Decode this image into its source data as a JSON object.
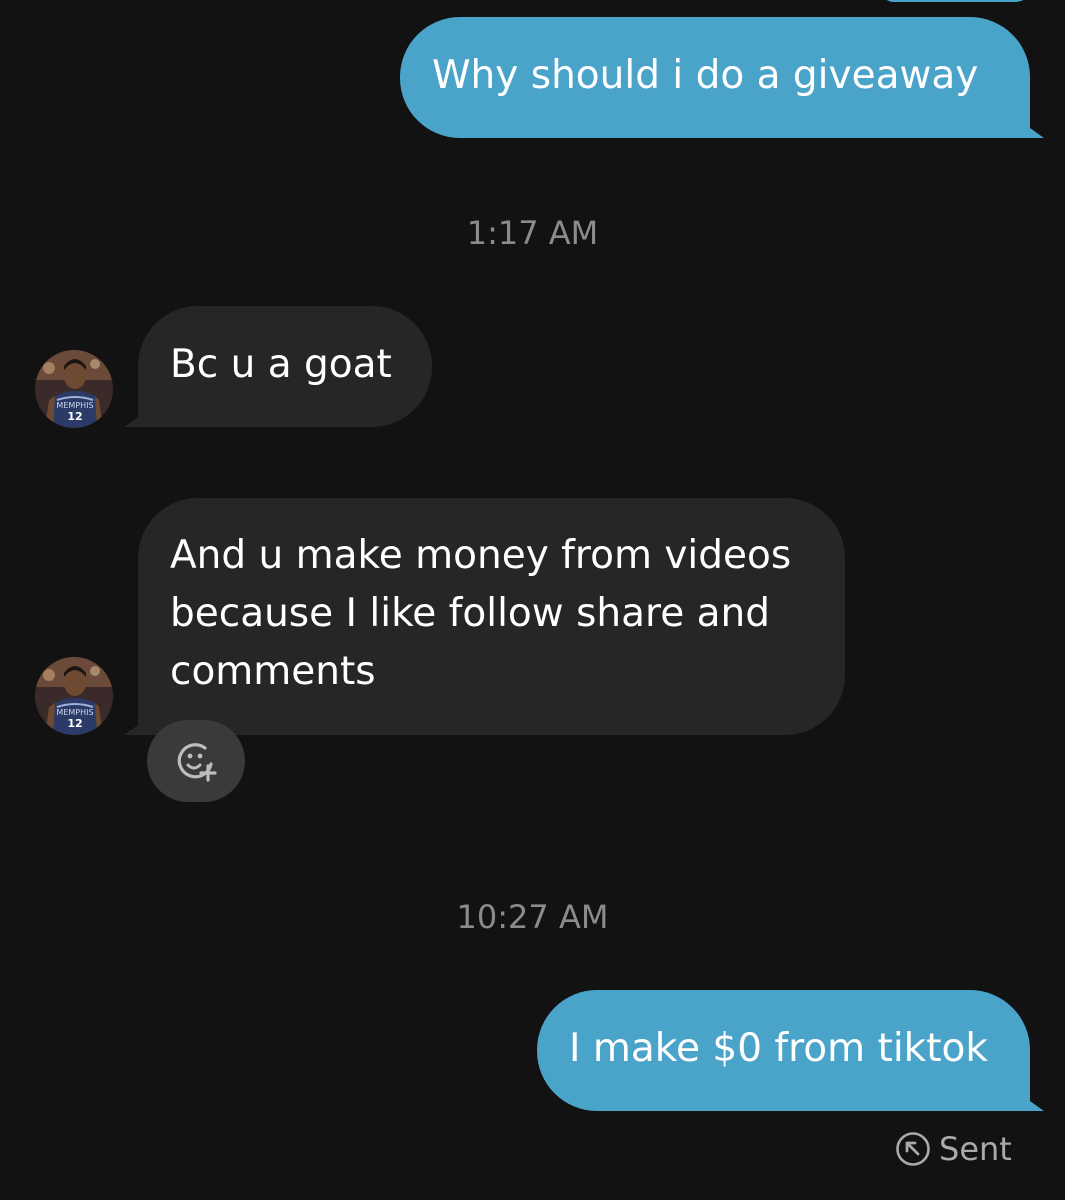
{
  "colors": {
    "background": "#121212",
    "outgoing_bubble": "#4aa3c9",
    "incoming_bubble": "#262626",
    "timestamp_text": "#8b8b8b"
  },
  "messages": [
    {
      "direction": "outgoing",
      "text": "Why should i do a giveaway"
    },
    {
      "direction": "timestamp",
      "text": "1:17 AM"
    },
    {
      "direction": "incoming",
      "text": "Bc u a goat"
    },
    {
      "direction": "incoming",
      "lines": [
        "And u make money from videos",
        "because I like follow share and",
        "comments"
      ]
    },
    {
      "direction": "timestamp",
      "text": "10:27 AM"
    },
    {
      "direction": "outgoing",
      "text": "I make $0 from tiktok"
    }
  ],
  "avatar": {
    "icon": "profile-photo-basketball-player",
    "jersey_text": "MEMPHIS",
    "jersey_number": "12"
  },
  "reaction_button": {
    "icon": "add-reaction-icon"
  },
  "status": {
    "icon": "sent-arrow-icon",
    "label": "Sent"
  }
}
